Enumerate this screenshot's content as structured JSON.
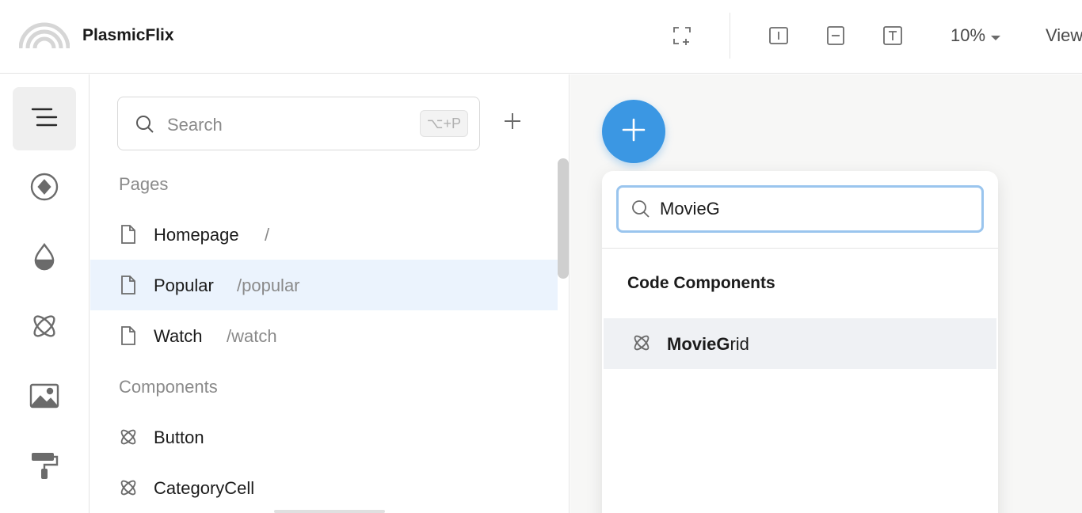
{
  "app": {
    "project_name": "PlasmicFlix"
  },
  "toolbar": {
    "zoom_label": "10%",
    "view_label": "View",
    "icons": [
      "focus-frame-icon",
      "vertical-stack-icon",
      "horizontal-stack-icon",
      "text-icon",
      "chevron-down-icon"
    ]
  },
  "rail": {
    "items": [
      {
        "name": "outline-icon",
        "active": true
      },
      {
        "name": "assets-icon",
        "active": false
      },
      {
        "name": "tokens-icon",
        "active": false
      },
      {
        "name": "components-icon",
        "active": false
      },
      {
        "name": "images-icon",
        "active": false
      },
      {
        "name": "mixins-icon",
        "active": false
      }
    ]
  },
  "outline": {
    "search_placeholder": "Search",
    "search_shortcut": "⌥+P",
    "pages_label": "Pages",
    "pages": [
      {
        "name": "Homepage",
        "path": "/"
      },
      {
        "name": "Popular",
        "path": "/popular",
        "selected": true
      },
      {
        "name": "Watch",
        "path": "/watch"
      }
    ],
    "components_label": "Components",
    "components": [
      {
        "name": "Button"
      },
      {
        "name": "CategoryCell"
      }
    ]
  },
  "insert_panel": {
    "search_value": "MovieG",
    "section_heading": "Code Components",
    "results": [
      {
        "match": "MovieG",
        "rest": "rid"
      }
    ]
  },
  "colors": {
    "accent": "#3b97e3",
    "selected_row": "#ebf3fd",
    "focus_ring": "#9ac5ee"
  }
}
